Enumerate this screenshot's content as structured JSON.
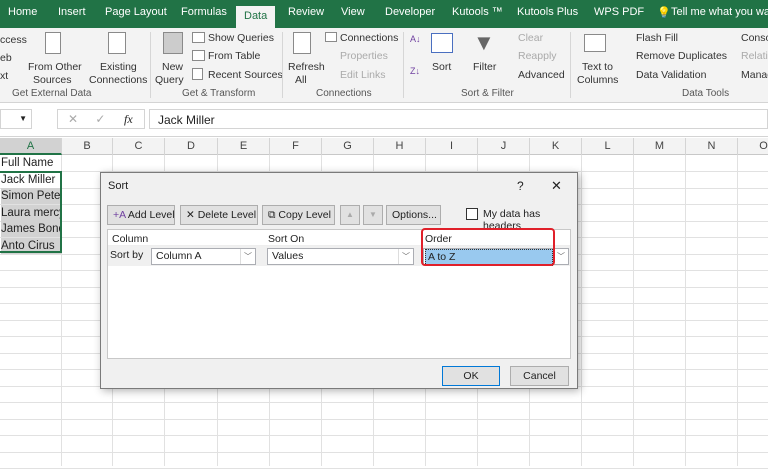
{
  "tabs": [
    "Home",
    "Insert",
    "Page Layout",
    "Formulas",
    "Data",
    "Review",
    "View",
    "Developer",
    "Kutools ™",
    "Kutools Plus",
    "WPS PDF",
    "Tell me what you want"
  ],
  "active_tab": "Data",
  "ribbon": {
    "get_external": {
      "items": [
        "ccess",
        "eb",
        "xt"
      ],
      "from_other": "From Other",
      "sources": "Sources",
      "existing": "Existing",
      "connections": "Connections",
      "group": "Get External Data"
    },
    "transform": {
      "new": "New",
      "query": "Query",
      "show_queries": "Show Queries",
      "from_table": "From Table",
      "recent_sources": "Recent Sources",
      "group": "Get & Transform"
    },
    "connections": {
      "refresh": "Refresh",
      "all": "All",
      "connections": "Connections",
      "properties": "Properties",
      "edit_links": "Edit Links",
      "group": "Connections"
    },
    "sort_filter": {
      "sort": "Sort",
      "filter": "Filter",
      "clear": "Clear",
      "reapply": "Reapply",
      "advanced": "Advanced",
      "group": "Sort & Filter"
    },
    "data_tools": {
      "text_to": "Text to",
      "columns": "Columns",
      "flash_fill": "Flash Fill",
      "remove_duplicates": "Remove Duplicates",
      "data_validation": "Data Validation",
      "conso": "Conso",
      "relatio": "Relatio",
      "manag": "Manag",
      "group": "Data Tools"
    }
  },
  "formula_bar": {
    "fx": "fx",
    "value": "Jack Miller"
  },
  "columns": [
    "A",
    "B",
    "C",
    "D",
    "E",
    "F",
    "G",
    "H",
    "I",
    "J",
    "K",
    "L",
    "M",
    "N",
    "O"
  ],
  "cells": [
    "Full Name",
    "Jack Miller",
    "Simon Peter",
    "Laura mercy",
    "James Bond",
    "Anto Cirus"
  ],
  "dialog": {
    "title": "Sort",
    "help": "?",
    "close": "✕",
    "add_level": "Add Level",
    "delete_level": "Delete Level",
    "copy_level": "Copy Level",
    "options": "Options...",
    "headers_label": "My data has headers",
    "headers_checked": false,
    "col_header": "Column",
    "sorton_header": "Sort On",
    "order_header": "Order",
    "sort_by": "Sort by",
    "column_value": "Column A",
    "sorton_value": "Values",
    "order_value": "A to Z",
    "ok": "OK",
    "cancel": "Cancel",
    "highlight_color": "#e0202a"
  }
}
